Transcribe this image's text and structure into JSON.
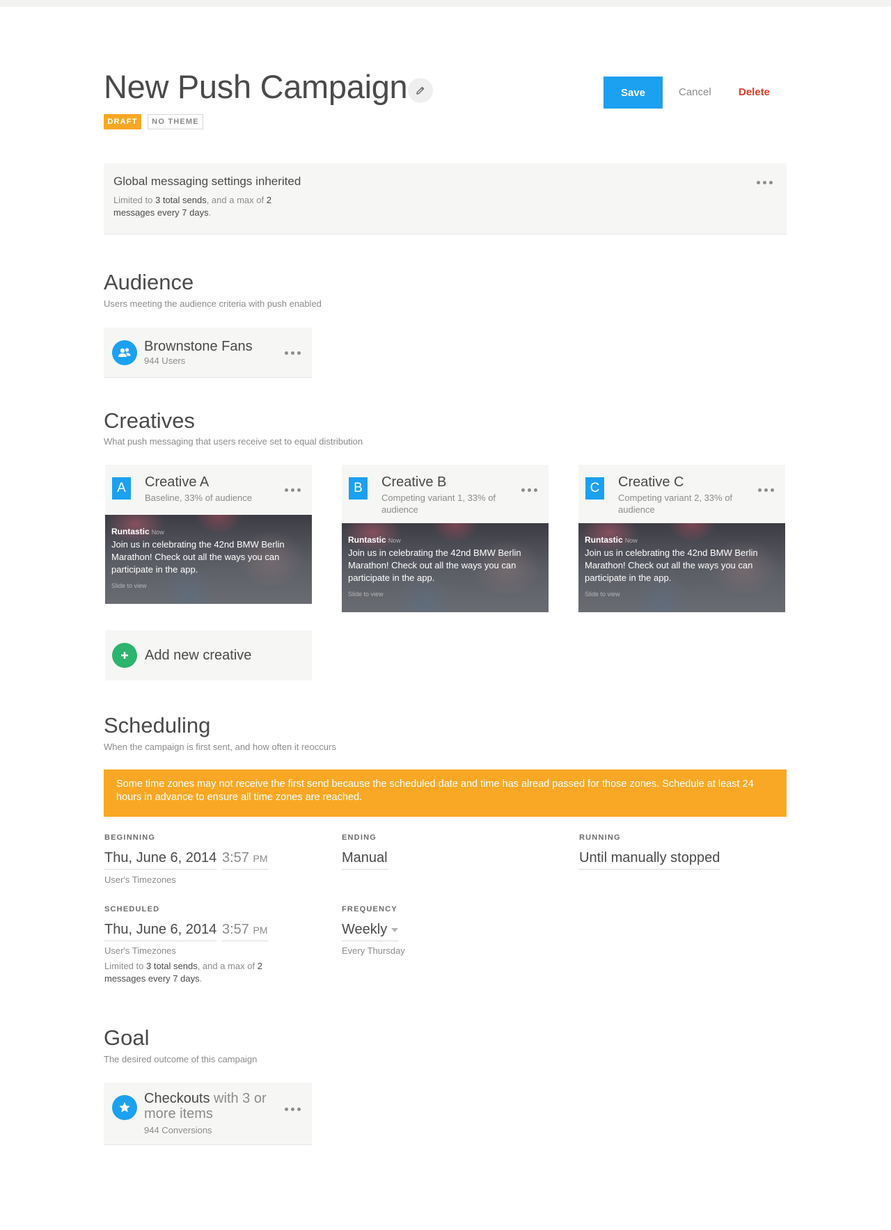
{
  "header": {
    "title": "New Push Campaign",
    "status_badge": "DRAFT",
    "theme_badge": "NO THEME",
    "save_label": "Save",
    "cancel_label": "Cancel",
    "delete_label": "Delete"
  },
  "global_settings": {
    "title": "Global messaging settings inherited",
    "desc_prefix": "Limited to ",
    "desc_sends": "3 total sends",
    "desc_mid": ", and a max of ",
    "desc_max": "2",
    "desc_max_suffix": "messages every 7 days",
    "desc_end": "."
  },
  "audience": {
    "title": "Audience",
    "subtitle": "Users meeting the audience criteria with push enabled",
    "segment_name": "Brownstone Fans",
    "segment_count": "944 Users"
  },
  "creatives": {
    "title": "Creatives",
    "subtitle": "What push messaging that users receive set to equal distribution",
    "items": [
      {
        "letter": "A",
        "name": "Creative A",
        "desc": "Baseline, 33% of audience"
      },
      {
        "letter": "B",
        "name": "Creative B",
        "desc": "Competing variant 1, 33% of audience"
      },
      {
        "letter": "C",
        "name": "Creative C",
        "desc": "Competing variant 2, 33% of audience"
      }
    ],
    "preview": {
      "app_name": "Runtastic",
      "time": "Now",
      "message": "Join us in celebrating the 42nd BMW Berlin Marathon! Check out all the ways you can participate in the app.",
      "slide_text": "Slide to view"
    },
    "add_label": "Add new creative"
  },
  "scheduling": {
    "title": "Scheduling",
    "subtitle": "When the campaign is first sent, and how often it reoccurs",
    "notice": "Some time zones may not receive the first send because the scheduled date and time has alread passed for those zones. Schedule at least 24 hours in advance to ensure all time zones are reached.",
    "beginning": {
      "label": "BEGINNING",
      "date": "Thu, June 6, 2014",
      "time": "3:57",
      "ampm": "PM",
      "note": "User's Timezones"
    },
    "ending": {
      "label": "ENDING",
      "value": "Manual"
    },
    "running": {
      "label": "RUNNING",
      "value": "Until manually stopped"
    },
    "scheduled": {
      "label": "SCHEDULED",
      "date": "Thu, June 6, 2014",
      "time": "3:57",
      "ampm": "PM",
      "note": "User's Timezones",
      "limit_prefix": "Limited to ",
      "limit_sends": "3 total sends",
      "limit_mid": ", and a max of ",
      "limit_max": "2",
      "limit_max_suffix": "messages every 7 days",
      "limit_end": "."
    },
    "frequency": {
      "label": "FREQUENCY",
      "value": "Weekly",
      "note": "Every Thursday"
    }
  },
  "goal": {
    "title": "Goal",
    "subtitle": "The desired outcome of this campaign",
    "name": "Checkouts",
    "name_suffix": " with 3 or more items",
    "count": "944 Conversions"
  },
  "colors": {
    "accent": "#1ca0f0",
    "warning": "#f9a825",
    "danger": "#e03a20",
    "success": "#2db46e"
  },
  "icons": {
    "edit": "pencil-icon",
    "audience": "users-icon",
    "add": "plus-icon",
    "goal": "star-icon",
    "more": "more-icon",
    "dropdown": "caret-down-icon"
  }
}
